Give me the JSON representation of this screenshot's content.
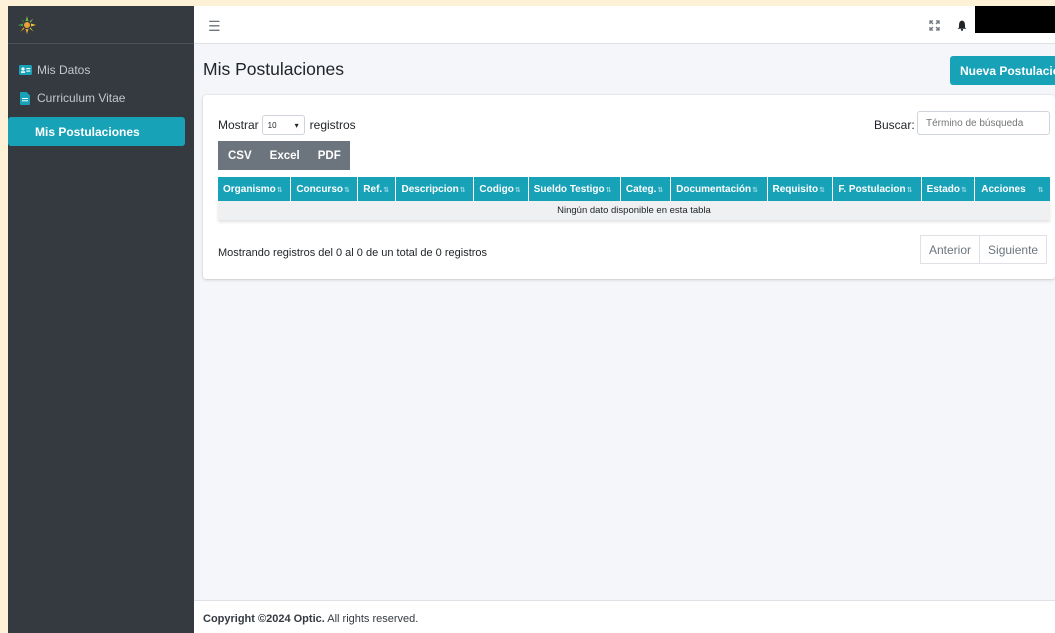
{
  "sidebar": {
    "items": [
      {
        "label": "Mis Datos",
        "icon": "id-card-icon"
      },
      {
        "label": "Curriculum Vitae",
        "icon": "file-icon"
      },
      {
        "label": "Mis Postulaciones",
        "active": true
      }
    ]
  },
  "header": {
    "menu_icon": "hamburger-icon",
    "expand_icon": "expand-icon",
    "bell_icon": "bell-icon"
  },
  "page": {
    "title": "Mis Postulaciones",
    "new_button": "Nueva Postulación"
  },
  "table_controls": {
    "show_label": "Mostrar",
    "page_length": "10",
    "records_label": "registros",
    "search_label": "Buscar:",
    "search_placeholder": "Término de búsqueda",
    "export": [
      "CSV",
      "Excel",
      "PDF"
    ]
  },
  "table": {
    "columns": [
      "Organismo",
      "Concurso",
      "Ref.",
      "Descripcion",
      "Codigo",
      "Sueldo Testigo",
      "Categ.",
      "Documentación",
      "Requisito",
      "F. Postulacion",
      "Estado",
      "Acciones"
    ],
    "empty_message": "Ningún dato disponible en esta tabla"
  },
  "pagination": {
    "info": "Mostrando registros del 0 al 0 de un total de 0 registros",
    "prev": "Anterior",
    "next": "Siguiente"
  },
  "footer": {
    "copyright": "Copyright ©2024 Optic.",
    "rights": "All rights reserved."
  },
  "colors": {
    "accent": "#17a2b8",
    "sidebar": "#343a40",
    "export": "#6c757d"
  }
}
